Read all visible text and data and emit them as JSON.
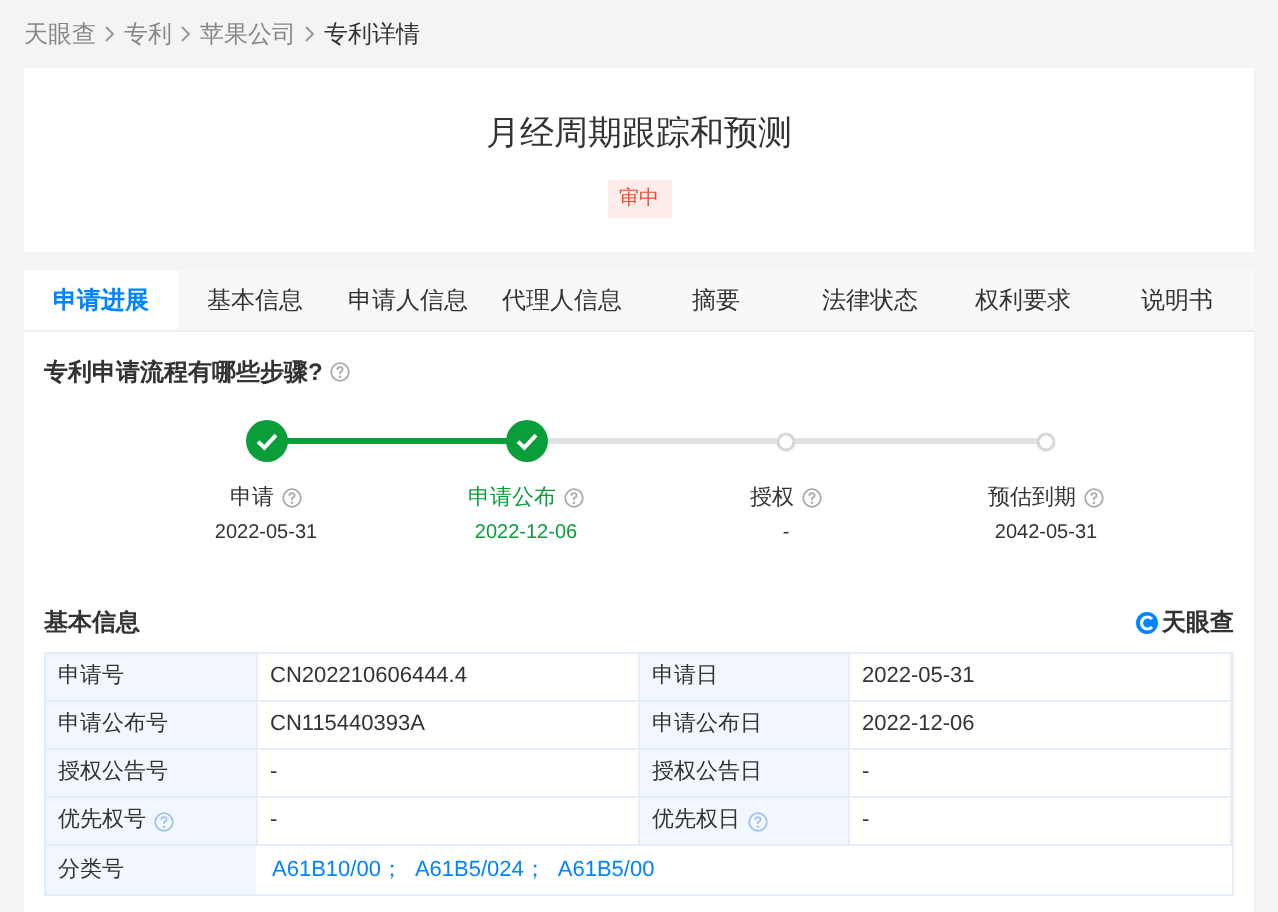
{
  "breadcrumb": [
    {
      "label": "天眼查",
      "current": false
    },
    {
      "label": "专利",
      "current": false
    },
    {
      "label": "苹果公司",
      "current": false
    },
    {
      "label": "专利详情",
      "current": true
    }
  ],
  "patent": {
    "title": "月经周期跟踪和预测",
    "status_badge": "审中"
  },
  "tabs": [
    {
      "label": "申请进展",
      "selected": true
    },
    {
      "label": "基本信息",
      "selected": false
    },
    {
      "label": "申请人信息",
      "selected": false
    },
    {
      "label": "代理人信息",
      "selected": false
    },
    {
      "label": "摘要",
      "selected": false
    },
    {
      "label": "法律状态",
      "selected": false
    },
    {
      "label": "权利要求",
      "selected": false
    },
    {
      "label": "说明书",
      "selected": false
    }
  ],
  "progress": {
    "heading": "专利申请流程有哪些步骤?",
    "steps": [
      {
        "label": "申请",
        "date": "2022-05-31",
        "done": true,
        "current": false
      },
      {
        "label": "申请公布",
        "date": "2022-12-06",
        "done": true,
        "current": true
      },
      {
        "label": "授权",
        "date": "-",
        "done": false,
        "current": false
      },
      {
        "label": "预估到期",
        "date": "2042-05-31",
        "done": false,
        "current": false
      }
    ]
  },
  "basic_info": {
    "heading": "基本信息",
    "logo_text": "天眼查",
    "rows": [
      {
        "cells": [
          {
            "label": "申请号",
            "value": "CN202210606444.4",
            "help": false
          },
          {
            "label": "申请日",
            "value": "2022-05-31",
            "help": false
          }
        ]
      },
      {
        "cells": [
          {
            "label": "申请公布号",
            "value": "CN115440393A",
            "help": false
          },
          {
            "label": "申请公布日",
            "value": "2022-12-06",
            "help": false
          }
        ]
      },
      {
        "cells": [
          {
            "label": "授权公告号",
            "value": "-",
            "help": false
          },
          {
            "label": "授权公告日",
            "value": "-",
            "help": false
          }
        ]
      },
      {
        "cells": [
          {
            "label": "优先权号",
            "value": "-",
            "help": true
          },
          {
            "label": "优先权日",
            "value": "-",
            "help": true
          }
        ]
      }
    ],
    "classification": {
      "label": "分类号",
      "separator": "；",
      "codes": [
        "A61B10/00",
        "A61B5/024",
        "A61B5/00"
      ]
    }
  }
}
